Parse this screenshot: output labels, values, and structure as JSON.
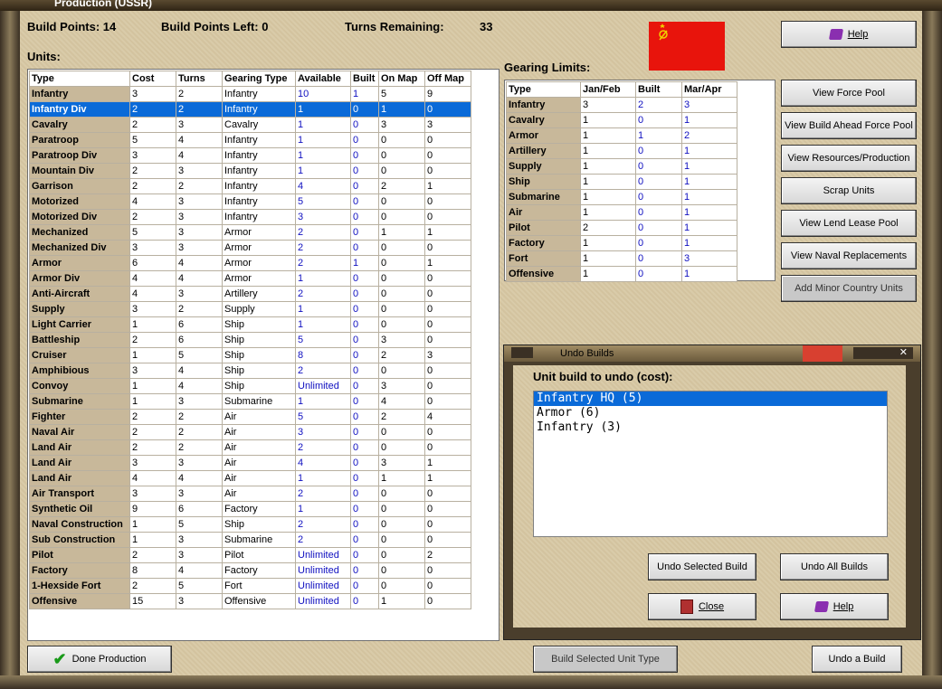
{
  "window": {
    "title": "Production (USSR)"
  },
  "summary": {
    "build_points_label": "Build Points:",
    "build_points": "14",
    "build_left_label": "Build Points Left:",
    "build_left": "0",
    "turns_label": "Turns Remaining:",
    "turns": "33"
  },
  "flag": {
    "color": "#e8140c",
    "emblem": "hammer-sickle"
  },
  "units": {
    "heading": "Units:",
    "columns": [
      "Type",
      "Cost",
      "Turns",
      "Gearing Type",
      "Available",
      "Built",
      "On Map",
      "Off Map"
    ],
    "selected_index": 1,
    "rows": [
      [
        "Infantry",
        "3",
        "2",
        "Infantry",
        "10",
        "1",
        "5",
        "9"
      ],
      [
        "Infantry Div",
        "2",
        "2",
        "Infantry",
        "1",
        "0",
        "1",
        "0"
      ],
      [
        "Cavalry",
        "2",
        "3",
        "Cavalry",
        "1",
        "0",
        "3",
        "3"
      ],
      [
        "Paratroop",
        "5",
        "4",
        "Infantry",
        "1",
        "0",
        "0",
        "0"
      ],
      [
        "Paratroop Div",
        "3",
        "4",
        "Infantry",
        "1",
        "0",
        "0",
        "0"
      ],
      [
        "Mountain Div",
        "2",
        "3",
        "Infantry",
        "1",
        "0",
        "0",
        "0"
      ],
      [
        "Garrison",
        "2",
        "2",
        "Infantry",
        "4",
        "0",
        "2",
        "1"
      ],
      [
        "Motorized",
        "4",
        "3",
        "Infantry",
        "5",
        "0",
        "0",
        "0"
      ],
      [
        "Motorized Div",
        "2",
        "3",
        "Infantry",
        "3",
        "0",
        "0",
        "0"
      ],
      [
        "Mechanized",
        "5",
        "3",
        "Armor",
        "2",
        "0",
        "1",
        "1"
      ],
      [
        "Mechanized Div",
        "3",
        "3",
        "Armor",
        "2",
        "0",
        "0",
        "0"
      ],
      [
        "Armor",
        "6",
        "4",
        "Armor",
        "2",
        "1",
        "0",
        "1"
      ],
      [
        "Armor Div",
        "4",
        "4",
        "Armor",
        "1",
        "0",
        "0",
        "0"
      ],
      [
        "Anti-Aircraft",
        "4",
        "3",
        "Artillery",
        "2",
        "0",
        "0",
        "0"
      ],
      [
        "Supply",
        "3",
        "2",
        "Supply",
        "1",
        "0",
        "0",
        "0"
      ],
      [
        "Light Carrier",
        "1",
        "6",
        "Ship",
        "1",
        "0",
        "0",
        "0"
      ],
      [
        "Battleship",
        "2",
        "6",
        "Ship",
        "5",
        "0",
        "3",
        "0"
      ],
      [
        "Cruiser",
        "1",
        "5",
        "Ship",
        "8",
        "0",
        "2",
        "3"
      ],
      [
        "Amphibious",
        "3",
        "4",
        "Ship",
        "2",
        "0",
        "0",
        "0"
      ],
      [
        "Convoy",
        "1",
        "4",
        "Ship",
        "Unlimited",
        "0",
        "3",
        "0"
      ],
      [
        "Submarine",
        "1",
        "3",
        "Submarine",
        "1",
        "0",
        "4",
        "0"
      ],
      [
        "Fighter",
        "2",
        "2",
        "Air",
        "5",
        "0",
        "2",
        "4"
      ],
      [
        "Naval Air",
        "2",
        "2",
        "Air",
        "3",
        "0",
        "0",
        "0"
      ],
      [
        "Land Air",
        "2",
        "2",
        "Air",
        "2",
        "0",
        "0",
        "0"
      ],
      [
        "Land Air",
        "3",
        "3",
        "Air",
        "4",
        "0",
        "3",
        "1"
      ],
      [
        "Land Air",
        "4",
        "4",
        "Air",
        "1",
        "0",
        "1",
        "1"
      ],
      [
        "Air Transport",
        "3",
        "3",
        "Air",
        "2",
        "0",
        "0",
        "0"
      ],
      [
        "Synthetic Oil",
        "9",
        "6",
        "Factory",
        "1",
        "0",
        "0",
        "0"
      ],
      [
        "Naval Construction",
        "1",
        "5",
        "Ship",
        "2",
        "0",
        "0",
        "0"
      ],
      [
        "Sub Construction",
        "1",
        "3",
        "Submarine",
        "2",
        "0",
        "0",
        "0"
      ],
      [
        "Pilot",
        "2",
        "3",
        "Pilot",
        "Unlimited",
        "0",
        "0",
        "2"
      ],
      [
        "Factory",
        "8",
        "4",
        "Factory",
        "Unlimited",
        "0",
        "0",
        "0"
      ],
      [
        "1-Hexside Fort",
        "2",
        "5",
        "Fort",
        "Unlimited",
        "0",
        "0",
        "0"
      ],
      [
        "Offensive",
        "15",
        "3",
        "Offensive",
        "Unlimited",
        "0",
        "1",
        "0"
      ]
    ]
  },
  "gearing": {
    "heading": "Gearing Limits:",
    "columns": [
      "Type",
      "Jan/Feb",
      "Built",
      "Mar/Apr"
    ],
    "rows": [
      [
        "Infantry",
        "3",
        "2",
        "3"
      ],
      [
        "Cavalry",
        "1",
        "0",
        "1"
      ],
      [
        "Armor",
        "1",
        "1",
        "2"
      ],
      [
        "Artillery",
        "1",
        "0",
        "1"
      ],
      [
        "Supply",
        "1",
        "0",
        "1"
      ],
      [
        "Ship",
        "1",
        "0",
        "1"
      ],
      [
        "Submarine",
        "1",
        "0",
        "1"
      ],
      [
        "Air",
        "1",
        "0",
        "1"
      ],
      [
        "Pilot",
        "2",
        "0",
        "1"
      ],
      [
        "Factory",
        "1",
        "0",
        "1"
      ],
      [
        "Fort",
        "1",
        "0",
        "3"
      ],
      [
        "Offensive",
        "1",
        "0",
        "1"
      ]
    ]
  },
  "buttons": {
    "help": "Help",
    "side": [
      "View Force Pool",
      "View Build Ahead Force Pool",
      "View Resources/Production",
      "Scrap Units",
      "View Lend Lease Pool",
      "View Naval Replacements",
      "Add Minor Country Units"
    ],
    "done": "Done Production",
    "build_selected": "Build Selected Unit Type",
    "undo_a_build": "Undo a Build"
  },
  "undo_window": {
    "title": "Undo Builds",
    "prompt": "Unit build to undo (cost):",
    "items": [
      "Infantry HQ (5)",
      "Armor (6)",
      "Infantry (3)"
    ],
    "selected_index": 0,
    "undo_selected": "Undo Selected Build",
    "undo_all": "Undo All Builds",
    "close": "Close",
    "help": "Help"
  }
}
